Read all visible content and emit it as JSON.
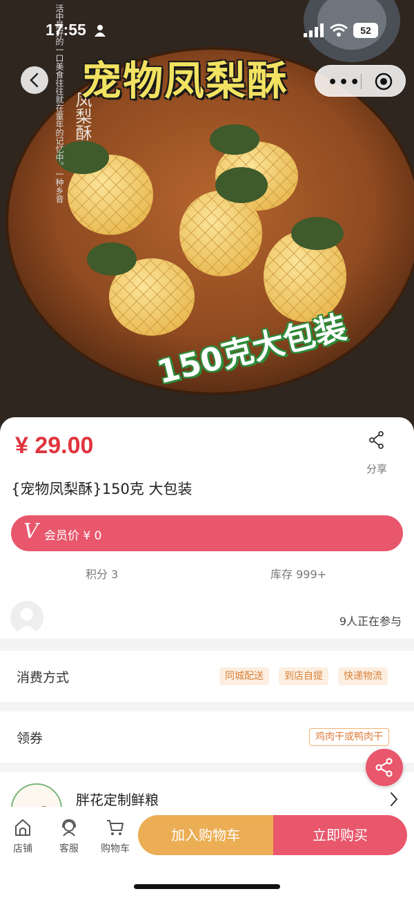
{
  "status_bar": {
    "time": "17:55",
    "battery": "52"
  },
  "hero": {
    "title": "宠物凤梨酥",
    "side_text": "凤梨酥",
    "poem": "活中最好的一口美食往往就在童年的记忆中。一种乡音",
    "weight_text": "150克大包装",
    "capsule_dots": "•••"
  },
  "product": {
    "price": "¥ 29.00",
    "share_label": "分享",
    "title": "{宠物凤梨酥}150克 大包装",
    "vip_letter": "V",
    "vip_text": "会员价 ¥ 0",
    "points": "积分 3",
    "stock": "库存 999+",
    "participants": "9人正在参与"
  },
  "consume": {
    "label": "消费方式",
    "tags": [
      "同城配送",
      "到店自提",
      "快递物流"
    ]
  },
  "coupon": {
    "label": "领券",
    "tag": "鸡肉干或鸭肉干"
  },
  "store": {
    "name": "胖花定制鲜粮"
  },
  "bottom_nav": {
    "items": [
      {
        "label": "店铺",
        "icon": "store-icon"
      },
      {
        "label": "客服",
        "icon": "customer-service-icon"
      },
      {
        "label": "购物车",
        "icon": "cart-icon"
      }
    ],
    "add_to_cart": "加入购物车",
    "buy_now": "立即购买"
  },
  "colors": {
    "price_red": "#e0343e",
    "accent_pink": "#e8576c",
    "cart_orange": "#ebae55",
    "tag_bg": "#fcefe1",
    "tag_text": "#d9823a"
  }
}
